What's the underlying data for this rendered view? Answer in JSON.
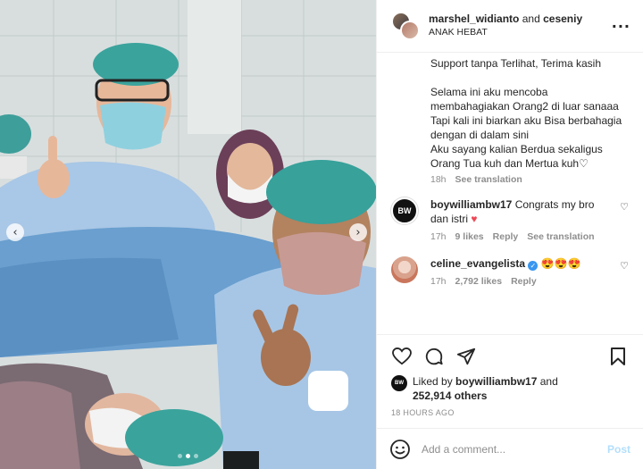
{
  "header": {
    "user1": "marshel_widianto",
    "joiner": "and",
    "user2": "ceseniy",
    "subtitle": "ANAK HEBAT"
  },
  "caption": {
    "text": "Support tanpa Terlihat, Terima kasih\n\nSelama ini aku mencoba membahagiakan Orang2 di luar sanaaa\nTapi kali ini biarkan aku Bisa berbahagia dengan di dalam sini\nAku sayang kalian Berdua sekaligus Orang Tua kuh dan Mertua kuh♡",
    "time": "18h",
    "see_translation": "See translation"
  },
  "comments": [
    {
      "avatar_text": "BW",
      "username": "boywilliambw17",
      "text": "Congrats my bro dan istri",
      "emoji": "♥",
      "time": "17h",
      "likes": "9 likes",
      "reply": "Reply",
      "see_translation": "See translation"
    },
    {
      "username": "celine_evangelista",
      "text": "😍😍😍",
      "time": "17h",
      "likes": "2,792 likes",
      "reply": "Reply"
    }
  ],
  "likes": {
    "avatar_text": "BW",
    "prefix": "Liked by",
    "user": "boywilliambw17",
    "joiner": "and",
    "count": "252,914 others"
  },
  "ago": "18 HOURS AGO",
  "add_comment": {
    "placeholder": "Add a comment...",
    "post": "Post"
  },
  "carousel": {
    "prev": "‹",
    "next": "›",
    "slides": 3,
    "active": 2
  },
  "colors": {
    "accent": "#3897f0",
    "heart": "#ed4956",
    "post_disabled": "#b2dffc"
  }
}
